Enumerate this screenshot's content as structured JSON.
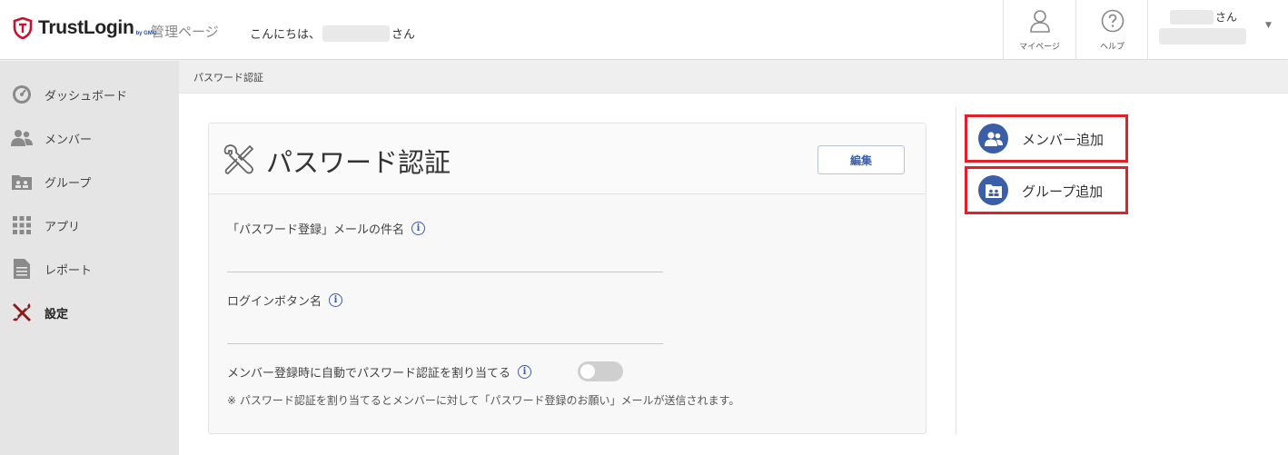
{
  "header": {
    "logo_text": "TrustLogin",
    "logo_sub": "by GMO",
    "admin_label": "管理ページ",
    "greeting_prefix": "こんにちは、",
    "greeting_suffix": "さん",
    "mypage_label": "マイページ",
    "help_label": "ヘルプ",
    "user_suffix": "さん"
  },
  "breadcrumb": "パスワード認証",
  "sidebar": {
    "items": [
      {
        "label": "ダッシュボード",
        "icon": "dashboard-icon"
      },
      {
        "label": "メンバー",
        "icon": "members-icon"
      },
      {
        "label": "グループ",
        "icon": "group-folder-icon"
      },
      {
        "label": "アプリ",
        "icon": "apps-grid-icon"
      },
      {
        "label": "レポート",
        "icon": "report-icon"
      },
      {
        "label": "設定",
        "icon": "tools-icon",
        "active": true
      }
    ]
  },
  "card": {
    "title": "パスワード認証",
    "edit_label": "編集",
    "field1_label": "「パスワード登録」メールの件名",
    "field1_value": "",
    "field2_label": "ログインボタン名",
    "field2_value": "",
    "toggle_label": "メンバー登録時に自動でパスワード認証を割り当てる",
    "toggle_on": false,
    "note": "※ パスワード認証を割り当てるとメンバーに対して「パスワード登録のお願い」メールが送信されます。",
    "info_glyph": "i"
  },
  "actions": {
    "add_member": "メンバー追加",
    "add_group": "グループ追加"
  },
  "colors": {
    "accent": "#3b5ea8",
    "highlight": "#e0202a",
    "sidebar_bg": "#e5e5e5",
    "logo_red": "#c8102e"
  }
}
